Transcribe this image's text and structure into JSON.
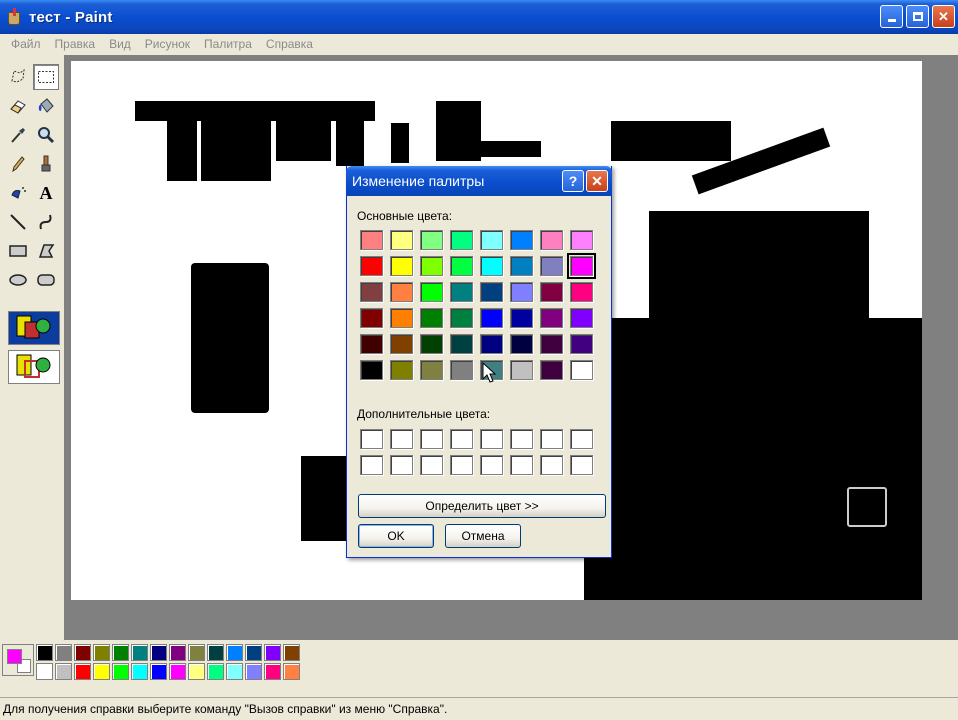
{
  "window": {
    "title": "тест - Paint",
    "icon": "paint-icon",
    "controls": [
      "minimize-icon",
      "restore-icon",
      "close-icon"
    ]
  },
  "menu": [
    "Файл",
    "Правка",
    "Вид",
    "Рисунок",
    "Палитра",
    "Справка"
  ],
  "tools": [
    {
      "name": "free-form-select-icon"
    },
    {
      "name": "rect-select-icon",
      "active": true
    },
    {
      "name": "eraser-icon"
    },
    {
      "name": "fill-bucket-icon"
    },
    {
      "name": "color-picker-icon"
    },
    {
      "name": "magnifier-icon"
    },
    {
      "name": "pencil-icon"
    },
    {
      "name": "brush-icon"
    },
    {
      "name": "airbrush-icon"
    },
    {
      "name": "text-icon",
      "glyph": "A"
    },
    {
      "name": "line-icon"
    },
    {
      "name": "curve-icon"
    },
    {
      "name": "rectangle-icon"
    },
    {
      "name": "polygon-icon"
    },
    {
      "name": "ellipse-icon"
    },
    {
      "name": "rounded-rect-icon"
    }
  ],
  "current_colors": {
    "foreground": "#ff00ff",
    "background": "#ffffff"
  },
  "palette_top": [
    "#000000",
    "#808080",
    "#800000",
    "#808000",
    "#008000",
    "#008080",
    "#000080",
    "#800080",
    "#808040",
    "#004040",
    "#0080ff",
    "#004080",
    "#8000ff",
    "#804000"
  ],
  "palette_bottom": [
    "#ffffff",
    "#c0c0c0",
    "#ff0000",
    "#ffff00",
    "#00ff00",
    "#00ffff",
    "#0000ff",
    "#ff00ff",
    "#ffff80",
    "#00ff80",
    "#80ffff",
    "#8080ff",
    "#ff0080",
    "#ff8040"
  ],
  "status": "Для получения справки выберите команду \"Вызов справки\" из меню \"Справка\".",
  "dialog": {
    "title": "Изменение палитры",
    "basic_label": "Основные цвета:",
    "custom_label": "Дополнительные цвета:",
    "define_button": "Определить цвет >>",
    "ok_button": "OK",
    "cancel_button": "Отмена",
    "basic_colors": [
      [
        "#ff8080",
        "#ffff80",
        "#80ff80",
        "#00ff80",
        "#80ffff",
        "#0080ff",
        "#ff80c0",
        "#ff80ff"
      ],
      [
        "#ff0000",
        "#ffff00",
        "#80ff00",
        "#00ff40",
        "#00ffff",
        "#0080c0",
        "#8080c0",
        "#ff00ff"
      ],
      [
        "#804040",
        "#ff8040",
        "#00ff00",
        "#008080",
        "#004080",
        "#8080ff",
        "#800040",
        "#ff0080"
      ],
      [
        "#800000",
        "#ff8000",
        "#008000",
        "#008040",
        "#0000ff",
        "#0000a0",
        "#800080",
        "#8000ff"
      ],
      [
        "#400000",
        "#804000",
        "#004000",
        "#004040",
        "#000080",
        "#000040",
        "#400040",
        "#400080"
      ],
      [
        "#000000",
        "#808000",
        "#808040",
        "#808080",
        "#408080",
        "#c0c0c0",
        "#400040",
        "#ffffff"
      ]
    ],
    "selected_cell": [
      1,
      7
    ],
    "custom_colors": [
      [
        "#ffffff",
        "#ffffff",
        "#ffffff",
        "#ffffff",
        "#ffffff",
        "#ffffff",
        "#ffffff",
        "#ffffff"
      ],
      [
        "#ffffff",
        "#ffffff",
        "#ffffff",
        "#ffffff",
        "#ffffff",
        "#ffffff",
        "#ffffff",
        "#ffffff"
      ]
    ]
  }
}
